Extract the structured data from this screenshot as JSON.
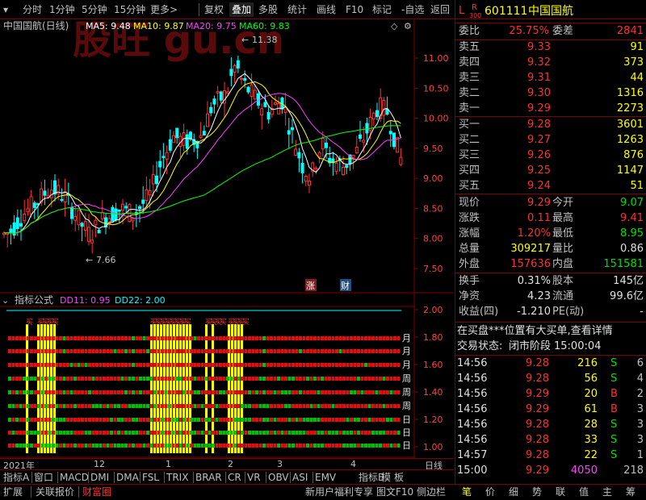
{
  "toolbar": {
    "items": [
      "分时",
      "1分钟",
      "5分钟",
      "15分钟",
      "更多>",
      "复权",
      "叠加",
      "多股",
      "统计",
      "画线",
      "F10",
      "标记",
      "-自选",
      "返回"
    ]
  },
  "chart": {
    "title": "中国国航(日线)",
    "ma5": "MA5: 9.48",
    "ma10": "MA10: 9.87",
    "ma20": "MA20: 9.75",
    "ma60": "MA60: 9.83",
    "high_label": "11.38",
    "low_label": "7.66",
    "badge_zhang": "涨",
    "badge_cai": "财",
    "watermark": "股旺 gu.cn",
    "y_ticks": [
      "11.00",
      "10.50",
      "10.00",
      "9.50",
      "9.00",
      "8.50",
      "8.00",
      "7.50"
    ],
    "colors": {
      "ma5": "#ffffff",
      "ma10": "#ffff00",
      "ma20": "#ff40ff",
      "ma60": "#00ff00",
      "up": "#ff3030",
      "down": "#00ffff"
    }
  },
  "indicator": {
    "title": "指标公式",
    "dd11": "DD11: 0.95",
    "dd22": "DD22: 2.00",
    "y_ticks": [
      "2.00",
      "1.80",
      "1.60",
      "1.40",
      "1.20",
      "1.00"
    ],
    "row_labels": [
      "月",
      "月",
      "月",
      "周",
      "周",
      "周",
      "日",
      "日",
      "日"
    ],
    "marker_text": "买",
    "x_labels": [
      "2021年",
      "12",
      "1",
      "2",
      "3",
      "4"
    ],
    "period": "日线"
  },
  "tabs_row1": [
    "指标A",
    "窗口",
    "MACD",
    "DMI",
    "DMA",
    "FSL",
    "TRIX",
    "BRAR",
    "CR",
    "VR",
    "OBV",
    "ASI",
    "EMV",
    "指标B",
    "模",
    "板"
  ],
  "tabs_row2": [
    "扩展",
    "关联报价",
    "财富圈"
  ],
  "tabs_row2_right": "新用户福利专享",
  "tabs_row2_f10": "图文F10",
  "tabs_row2_side": "侧边栏",
  "right": {
    "code": "601111",
    "name": "中国国航",
    "l_label": "L",
    "r_label": "R",
    "r_sub": "300",
    "weibi_label": "委比",
    "weibi": "25.75%",
    "weicha_label": "委差",
    "weicha": "2841",
    "asks": [
      {
        "label": "卖五",
        "price": "9.33",
        "vol": "91"
      },
      {
        "label": "卖四",
        "price": "9.32",
        "vol": "373"
      },
      {
        "label": "卖三",
        "price": "9.31",
        "vol": "44"
      },
      {
        "label": "卖二",
        "price": "9.30",
        "vol": "1316"
      },
      {
        "label": "卖一",
        "price": "9.29",
        "vol": "2273"
      }
    ],
    "bids": [
      {
        "label": "买一",
        "price": "9.28",
        "vol": "3601"
      },
      {
        "label": "买二",
        "price": "9.27",
        "vol": "1263"
      },
      {
        "label": "买三",
        "price": "9.26",
        "vol": "876"
      },
      {
        "label": "买四",
        "price": "9.25",
        "vol": "1147"
      },
      {
        "label": "买五",
        "price": "9.24",
        "vol": "51"
      }
    ],
    "stats": [
      {
        "l1": "现价",
        "v1": "9.29",
        "l2": "今开",
        "v2": "9.07"
      },
      {
        "l1": "涨跌",
        "v1": "0.11",
        "l2": "最高",
        "v2": "9.41"
      },
      {
        "l1": "涨幅",
        "v1": "1.20%",
        "l2": "最低",
        "v2": "8.95"
      },
      {
        "l1": "总量",
        "v1": "309217",
        "l2": "量比",
        "v2": "0.86"
      },
      {
        "l1": "外盘",
        "v1": "157636",
        "l2": "内盘",
        "v2": "151581"
      }
    ],
    "stats2": [
      {
        "l1": "换手",
        "v1": "0.31%",
        "l2": "股本",
        "v2": "145亿"
      },
      {
        "l1": "净资",
        "v1": "4.23",
        "l2": "流通",
        "v2": "99.6亿"
      },
      {
        "l1": "收益(四)",
        "v1": "-1.210",
        "l2": "PE(动)",
        "v2": "-"
      }
    ],
    "news": "在买盘***位置有大买单,查看详情",
    "status_label": "交易状态:",
    "status_value": "闭市阶段",
    "status_time": "15:00:04",
    "trades": [
      {
        "t": "14:56",
        "p": "9.28",
        "v": "216",
        "s": "S",
        "n": "6"
      },
      {
        "t": "14:56",
        "p": "9.28",
        "v": "56",
        "s": "S",
        "n": "4"
      },
      {
        "t": "14:56",
        "p": "9.29",
        "v": "20",
        "s": "B",
        "n": "2"
      },
      {
        "t": "14:56",
        "p": "9.29",
        "v": "61",
        "s": "B",
        "n": "3"
      },
      {
        "t": "14:56",
        "p": "9.28",
        "v": "28",
        "s": "S",
        "n": "3"
      },
      {
        "t": "14:56",
        "p": "9.28",
        "v": "33",
        "s": "S",
        "n": "3"
      },
      {
        "t": "14:57",
        "p": "9.28",
        "v": "22",
        "s": "S",
        "n": "1"
      },
      {
        "t": "15:00",
        "p": "9.29",
        "v": "4050",
        "s": "",
        "n": "218"
      }
    ],
    "bottom_tabs": [
      "笔",
      "价",
      "细",
      "势",
      "联",
      "值",
      "主",
      "筹"
    ]
  }
}
